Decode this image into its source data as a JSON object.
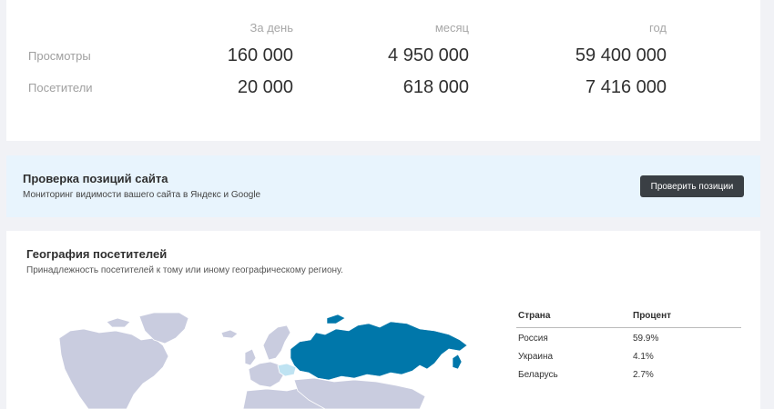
{
  "stats": {
    "columns": [
      "За день",
      "месяц",
      "год"
    ],
    "rows": [
      {
        "label": "Просмотры",
        "values": [
          "160 000",
          "4 950 000",
          "59 400 000"
        ]
      },
      {
        "label": "Посетители",
        "values": [
          "20 000",
          "618 000",
          "7 416 000"
        ]
      }
    ]
  },
  "positions_banner": {
    "title": "Проверка позиций сайта",
    "subtitle": "Мониторинг видимости вашего сайта в Яндекс и Google",
    "button_label": "Проверить позиции"
  },
  "geography": {
    "title": "География посетителей",
    "subtitle": "Принадлежность посетителей к тому или иному географическому региону.",
    "map": {
      "base_color": "#c9ccdf",
      "highlight_color": "#0077aa",
      "secondary_color": "#bfe3f2",
      "highlighted_country_icon": "russia-region",
      "secondary_country_icon": "ukraine-region"
    },
    "table": {
      "headers": [
        "Страна",
        "Процент"
      ],
      "rows": [
        {
          "country": "Россия",
          "percent": "59.9%"
        },
        {
          "country": "Украина",
          "percent": "4.1%"
        },
        {
          "country": "Беларусь",
          "percent": "2.7%"
        }
      ]
    }
  }
}
